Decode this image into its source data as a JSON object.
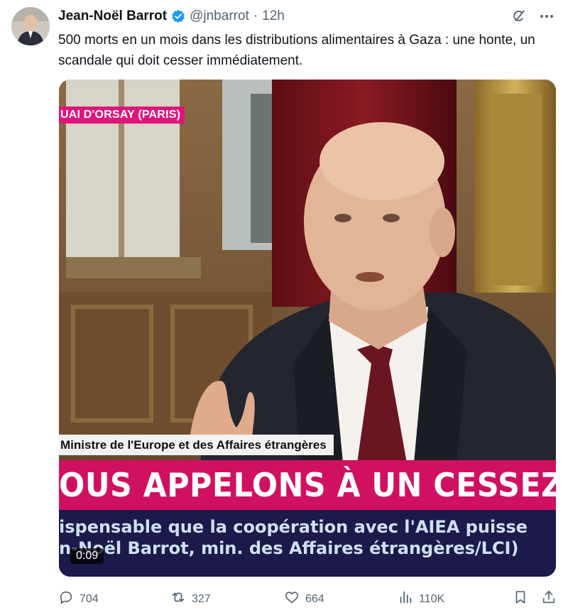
{
  "tweet": {
    "author_name": "Jean-Noël Barrot",
    "handle": "@jnbarrot",
    "separator": "·",
    "time": "12h",
    "text": "500 morts en un mois dans les distributions alimentaires à Gaza :  une honte, un scandale qui doit cesser immédiatement."
  },
  "video": {
    "location_badge": "UAI D'ORSAY (PARIS)",
    "caption": "Ministre de l'Europe et des Affaires étrangères",
    "headline": "OUS APPELONS À UN CESSEZ-LE-FE",
    "ticker_line1": "ispensable que la coopération avec l'AIEA puisse",
    "ticker_line2": "n-Noël Barrot, min. des Affaires étrangères/LCI)",
    "timecode": "0:09"
  },
  "stats": {
    "replies": "704",
    "reposts": "327",
    "likes": "664",
    "views": "110K"
  },
  "icons": {
    "verified": "verified-badge-icon",
    "grok": "grok-icon",
    "more": "more-icon",
    "reply": "reply-icon",
    "repost": "repost-icon",
    "like": "like-icon",
    "views": "views-icon",
    "bookmark": "bookmark-icon",
    "share": "share-icon"
  },
  "colors": {
    "verified_blue": "#1d9bf0",
    "muted_gray": "#536471",
    "badge_pink": "#e0157a",
    "headline_red": "#d01160",
    "ticker_navy": "#1c1a4a"
  }
}
